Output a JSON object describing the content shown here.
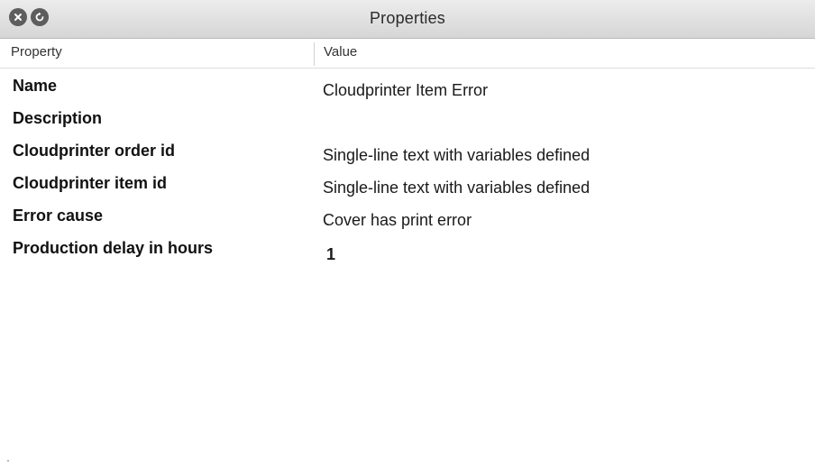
{
  "window": {
    "title": "Properties"
  },
  "controls": {
    "close_icon": "close-icon",
    "refresh_icon": "refresh-icon"
  },
  "table": {
    "headers": {
      "property": "Property",
      "value": "Value"
    },
    "rows": [
      {
        "property": "Name",
        "value": "Cloudprinter Item Error"
      },
      {
        "property": "Description",
        "value": ""
      },
      {
        "property": "Cloudprinter order id",
        "value": "Single-line text with variables defined"
      },
      {
        "property": "Cloudprinter item id",
        "value": "Single-line text with variables defined"
      },
      {
        "property": "Error cause",
        "value": "Cover has print error"
      },
      {
        "property": "Production delay in hours",
        "value": "1"
      }
    ]
  }
}
